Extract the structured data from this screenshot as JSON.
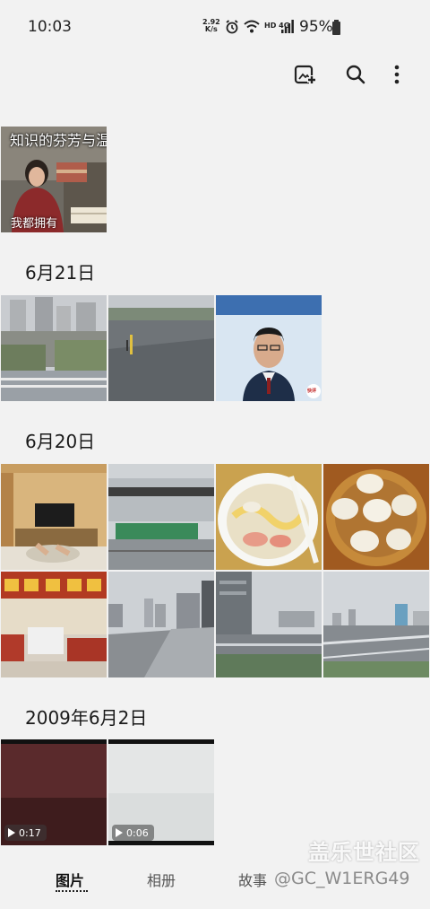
{
  "status_bar": {
    "time": "10:03",
    "speed_top": "2.92",
    "speed_bottom": "K/s",
    "network": "HD 4G",
    "battery": "95%"
  },
  "toolbar": {
    "create_icon": "add-to-collage-icon",
    "search_icon": "search-icon",
    "more_icon": "more-vert-icon"
  },
  "featured": {
    "caption_top": "知识的芬芳与温柔的力量",
    "caption_bottom": "我都拥有"
  },
  "sections": [
    {
      "date": "6月21日"
    },
    {
      "date": "6月20日"
    },
    {
      "date": "2009年6月2日"
    }
  ],
  "videos": [
    {
      "duration": "0:17"
    },
    {
      "duration": "0:06"
    }
  ],
  "news_thumb": {
    "badge": "快评"
  },
  "bottom_nav": {
    "tabs": [
      {
        "label": "图片",
        "active": true
      },
      {
        "label": "相册",
        "active": false
      },
      {
        "label": "故事",
        "active": false
      }
    ]
  },
  "watermark": {
    "site": "盖乐世社区",
    "user": "@GC_W1ERG49"
  }
}
